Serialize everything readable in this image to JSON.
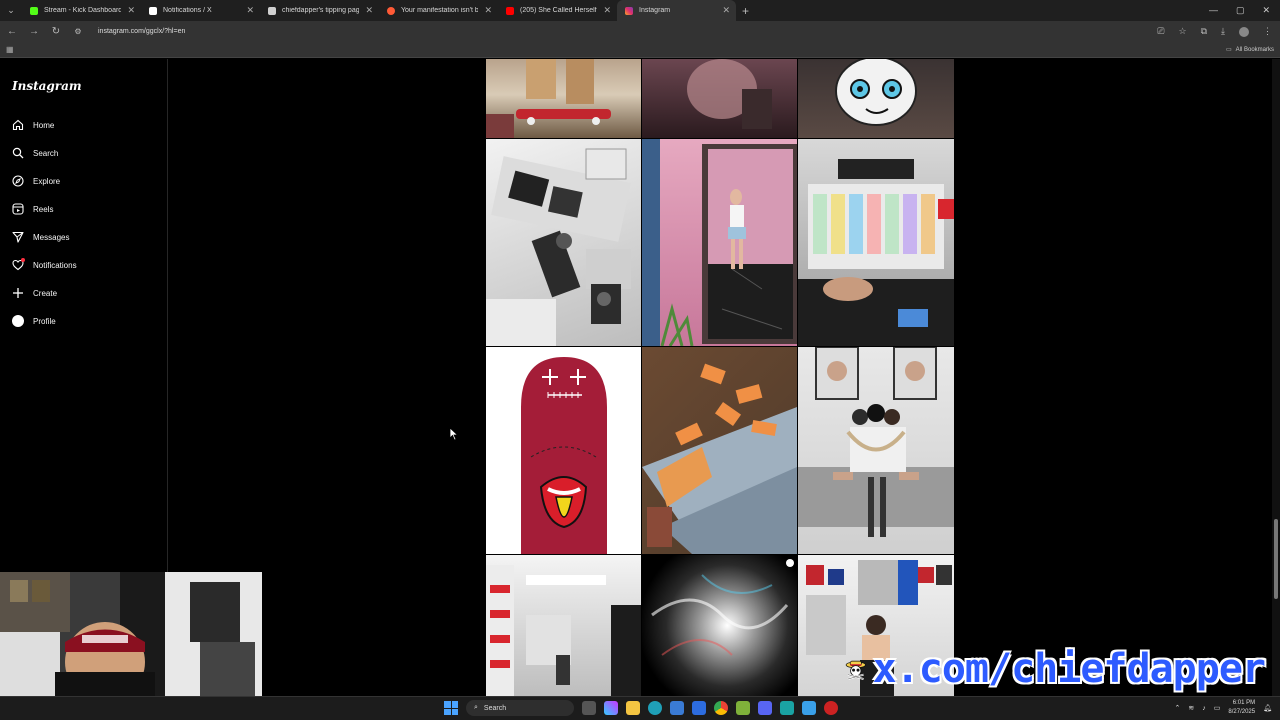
{
  "browser": {
    "tabs": [
      {
        "title": "Stream - Kick Dashboard",
        "color": "#53fc18"
      },
      {
        "title": "Notifications / X",
        "color": "#ffffff"
      },
      {
        "title": "chiefdapper's tipping page",
        "color": "#d0d0d0"
      },
      {
        "title": "Your manifestation isn't being i",
        "color": "#ff5a36"
      },
      {
        "title": "(205) She Called Herself A 10...",
        "color": "#ff0000"
      },
      {
        "title": "Instagram",
        "color": "#e1306c"
      }
    ],
    "new_tab": "+",
    "url": "instagram.com/ggclx/?hl=en",
    "all_bookmarks": "All Bookmarks"
  },
  "instagram": {
    "logo": "Instagram",
    "nav": [
      {
        "label": "Home",
        "icon": "home-icon"
      },
      {
        "label": "Search",
        "icon": "search-icon"
      },
      {
        "label": "Explore",
        "icon": "compass-icon"
      },
      {
        "label": "Reels",
        "icon": "reels-icon"
      },
      {
        "label": "Messages",
        "icon": "messenger-icon"
      },
      {
        "label": "Notifications",
        "icon": "heart-icon"
      },
      {
        "label": "Create",
        "icon": "plus-icon"
      },
      {
        "label": "Profile",
        "icon": "profile-avatar-icon"
      }
    ]
  },
  "watermark": {
    "text": "x.com/chiefdapper"
  },
  "taskbar": {
    "search_label": "Search",
    "time": "6:01 PM",
    "date": "8/27/2025"
  }
}
